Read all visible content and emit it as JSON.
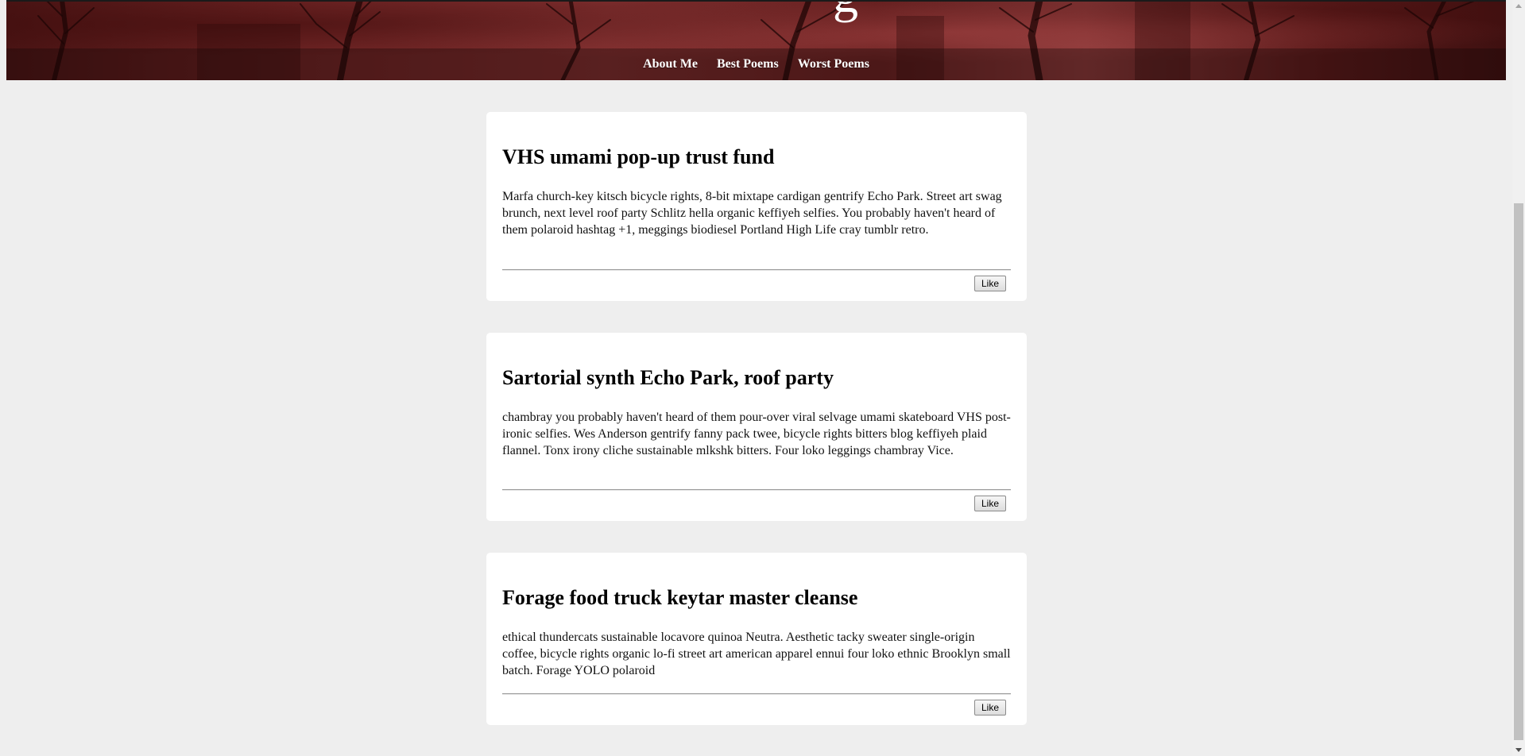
{
  "header": {
    "title_fragment": "g",
    "background_color": "#6e2424",
    "nav": [
      {
        "label": "About Me"
      },
      {
        "label": "Best Poems"
      },
      {
        "label": "Worst Poems"
      }
    ]
  },
  "posts": [
    {
      "title": "VHS umami pop-up trust fund",
      "body": "Marfa church-key kitsch bicycle rights, 8-bit mixtape cardigan gentrify Echo Park. Street art swag brunch, next level roof party Schlitz hella organic keffiyeh selfies. You probably haven't heard of them polaroid hashtag +1, meggings biodiesel Portland High Life cray tumblr retro.",
      "like_label": "Like"
    },
    {
      "title": "Sartorial synth Echo Park, roof party",
      "body": "chambray you probably haven't heard of them pour-over viral selvage umami skateboard VHS post-ironic selfies. Wes Anderson gentrify fanny pack twee, bicycle rights bitters blog keffiyeh plaid flannel. Tonx irony cliche sustainable mlkshk bitters. Four loko leggings chambray Vice.",
      "like_label": "Like"
    },
    {
      "title": "Forage food truck keytar master cleanse",
      "body": "ethical thundercats sustainable locavore quinoa Neutra. Aesthetic tacky sweater single-origin coffee, bicycle rights organic lo-fi street art american apparel ennui four loko ethnic Brooklyn small batch. Forage YOLO polaroid",
      "like_label": "Like"
    }
  ],
  "colors": {
    "page_background": "#eeeeee",
    "card_background": "#ffffff",
    "nav_text": "#ffffff"
  }
}
